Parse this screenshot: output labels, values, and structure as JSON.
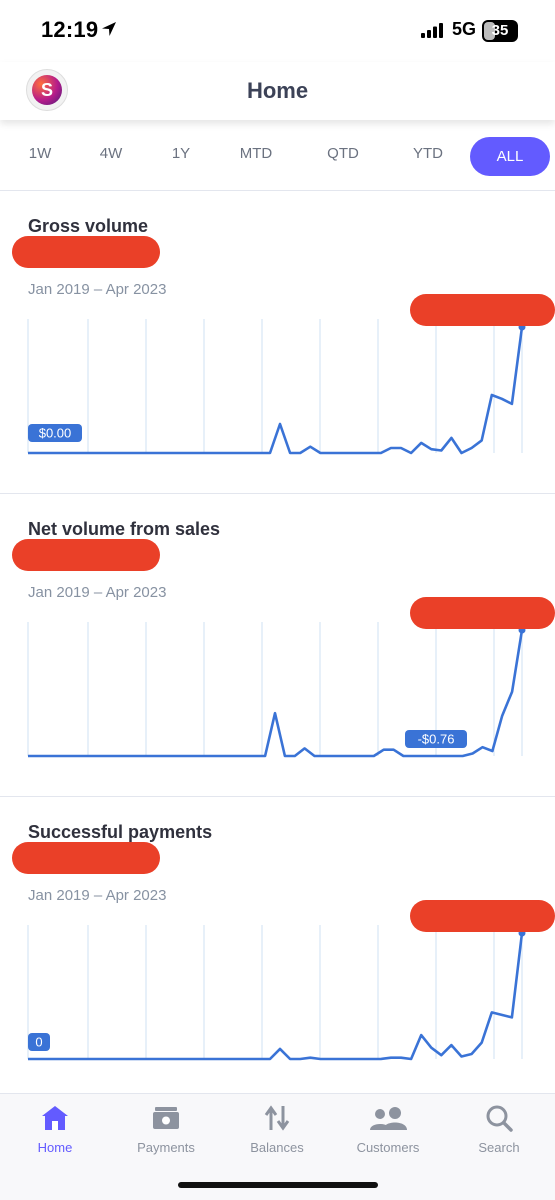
{
  "status_bar": {
    "time": "12:19",
    "network": "5G",
    "battery_level": "35",
    "icons": [
      "location-arrow-icon",
      "signal-icon",
      "battery-icon"
    ]
  },
  "header": {
    "title": "Home",
    "avatar_icon": "account-logo-icon"
  },
  "range_tabs": {
    "items": [
      "1W",
      "4W",
      "1Y",
      "MTD",
      "QTD",
      "YTD",
      "ALL"
    ],
    "selected": "ALL"
  },
  "colors": {
    "accent": "#635bff",
    "line": "#3a73d6",
    "redaction": "#ea4028",
    "gridline": "#cfe0f3"
  },
  "cards": [
    {
      "title": "Gross volume",
      "date_range": "Jan 2019 – Apr 2023",
      "badge": "$0.00"
    },
    {
      "title": "Net volume from sales",
      "date_range": "Jan 2019 – Apr 2023",
      "badge": "-$0.76"
    },
    {
      "title": "Successful payments",
      "date_range": "Jan 2019 – Apr 2023",
      "badge": "0"
    }
  ],
  "bottom_nav": {
    "items": [
      {
        "label": "Home",
        "icon": "home-icon",
        "active": true
      },
      {
        "label": "Payments",
        "icon": "payments-icon",
        "active": false
      },
      {
        "label": "Balances",
        "icon": "balances-arrows-icon",
        "active": false
      },
      {
        "label": "Customers",
        "icon": "customers-icon",
        "active": false
      },
      {
        "label": "Search",
        "icon": "search-icon",
        "active": false
      }
    ]
  },
  "chart_data": [
    {
      "type": "line",
      "title": "Gross volume",
      "x_range": [
        "Jan 2019",
        "Apr 2023"
      ],
      "values": [
        0,
        0,
        0,
        0,
        0,
        0,
        0,
        0,
        0,
        0,
        0,
        0,
        0,
        0,
        0,
        0,
        0,
        0,
        0,
        0,
        0,
        0,
        0,
        0,
        0,
        23,
        0,
        0,
        5,
        0,
        0,
        0,
        0,
        0,
        0,
        0,
        4,
        4,
        0,
        8,
        3,
        2,
        12,
        0,
        4,
        10,
        46,
        43,
        39,
        100
      ],
      "annotations": [
        "$0.00"
      ]
    },
    {
      "type": "line",
      "title": "Net volume from sales",
      "x_range": [
        "Jan 2019",
        "Apr 2023"
      ],
      "values": [
        0,
        0,
        0,
        0,
        0,
        0,
        0,
        0,
        0,
        0,
        0,
        0,
        0,
        0,
        0,
        0,
        0,
        0,
        0,
        0,
        0,
        0,
        0,
        0,
        0,
        34,
        0,
        0,
        6,
        0,
        0,
        0,
        0,
        0,
        0,
        0,
        5,
        5,
        0,
        0,
        0,
        0,
        0,
        0,
        0,
        2,
        7,
        4,
        32,
        51,
        100
      ],
      "annotations": [
        "-$0.76"
      ]
    },
    {
      "type": "line",
      "title": "Successful payments",
      "x_range": [
        "Jan 2019",
        "Apr 2023"
      ],
      "values": [
        0,
        0,
        0,
        0,
        0,
        0,
        0,
        0,
        0,
        0,
        0,
        0,
        0,
        0,
        0,
        0,
        0,
        0,
        0,
        0,
        0,
        0,
        0,
        0,
        0,
        8,
        0,
        0,
        1,
        0,
        0,
        0,
        0,
        0,
        0,
        0,
        1,
        1,
        0,
        19,
        9,
        3,
        11,
        2,
        4,
        13,
        37,
        35,
        33,
        100
      ],
      "annotations": [
        "0"
      ]
    }
  ]
}
